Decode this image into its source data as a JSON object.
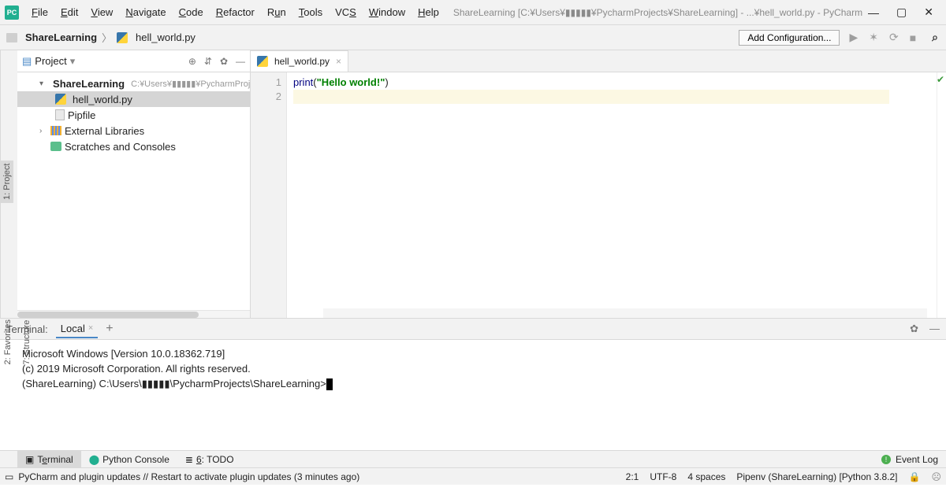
{
  "menubar": {
    "items": [
      "File",
      "Edit",
      "View",
      "Navigate",
      "Code",
      "Refactor",
      "Run",
      "Tools",
      "VCS",
      "Window",
      "Help"
    ],
    "title": "ShareLearning [C:¥Users¥▮▮▮▮▮¥PycharmProjects¥ShareLearning] - ...¥hell_world.py - PyCharm"
  },
  "breadcrumb": {
    "project": "ShareLearning",
    "file": "hell_world.py"
  },
  "toolbar": {
    "add_config": "Add Configuration..."
  },
  "project_pane": {
    "title": "Project",
    "root": {
      "name": "ShareLearning",
      "path": "C:¥Users¥▮▮▮▮▮¥PycharmProjects"
    },
    "children": [
      {
        "name": "hell_world.py",
        "type": "py",
        "selected": true
      },
      {
        "name": "Pipfile",
        "type": "file"
      }
    ],
    "external": "External Libraries",
    "scratches": "Scratches and Consoles"
  },
  "left_stripe": {
    "project": "1: Project"
  },
  "side_stripe": {
    "favorites": "2: Favorites",
    "structure": "7: Structure"
  },
  "editor": {
    "tab": "hell_world.py",
    "lines": [
      "1",
      "2"
    ],
    "code": "print(\"Hello world!\")"
  },
  "terminal": {
    "header": "Terminal:",
    "tab": "Local",
    "lines": [
      "Microsoft Windows [Version 10.0.18362.719]",
      "(c) 2019 Microsoft Corporation. All rights reserved.",
      "",
      "(ShareLearning) C:\\Users\\▮▮▮▮▮\\PycharmProjects\\ShareLearning>"
    ]
  },
  "bottom_tabs": {
    "terminal": "Terminal",
    "python_console": "Python Console",
    "todo": "6: TODO",
    "event_log": "Event Log"
  },
  "status": {
    "message": "PyCharm and plugin updates // Restart to activate plugin updates (3 minutes ago)",
    "pos": "2:1",
    "encoding": "UTF-8",
    "indent": "4 spaces",
    "interpreter": "Pipenv (ShareLearning) [Python 3.8.2]"
  }
}
